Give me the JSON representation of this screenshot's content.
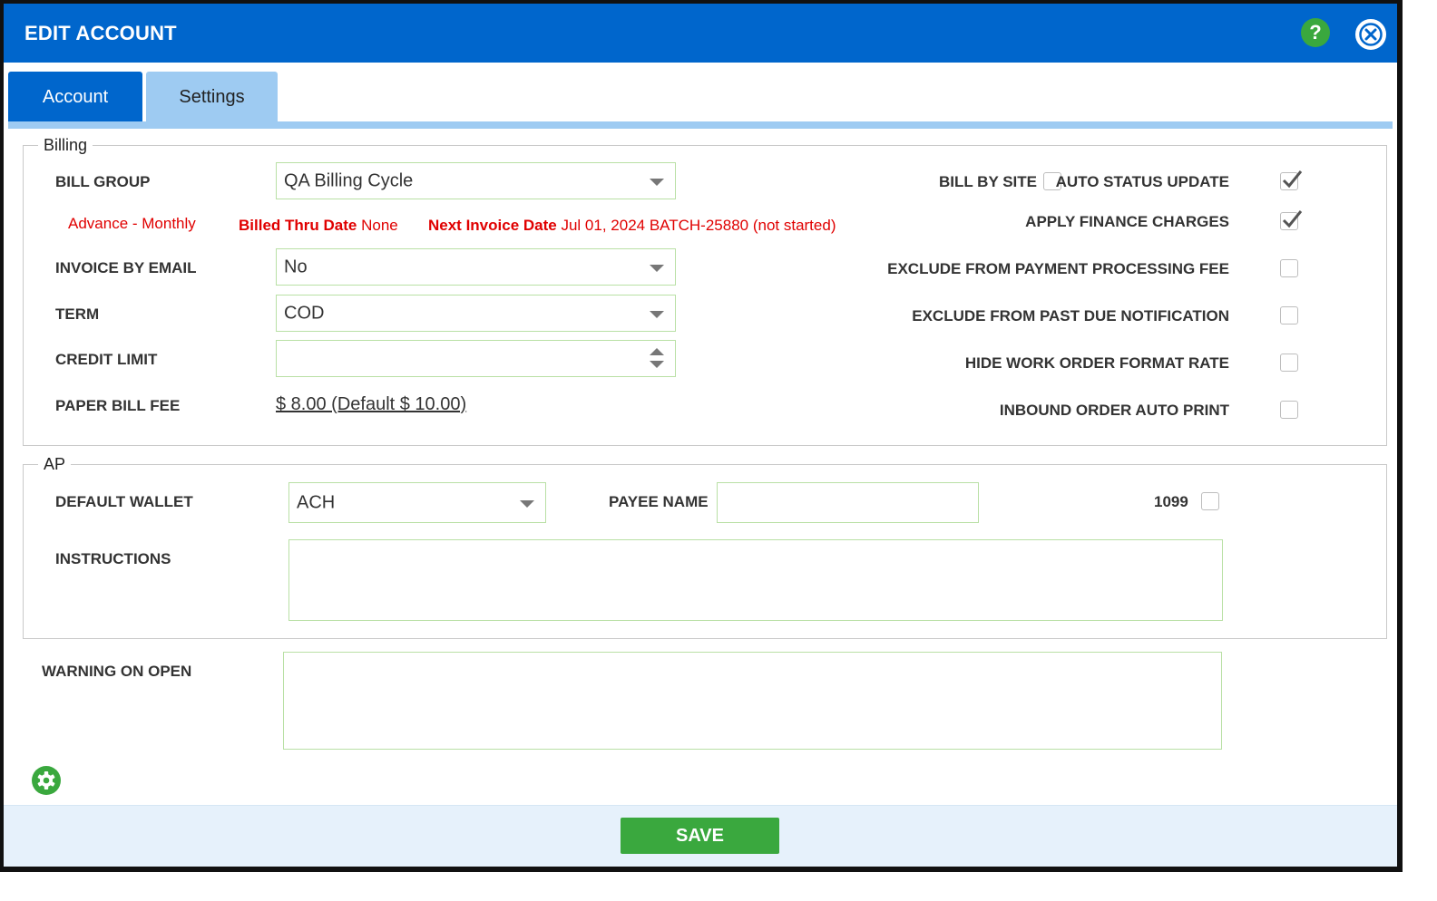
{
  "dialog": {
    "title": "EDIT ACCOUNT",
    "help_icon": "question-mark-icon",
    "help_glyph": "?",
    "close_icon": "close-icon"
  },
  "tabs": [
    {
      "label": "Account",
      "active": true
    },
    {
      "label": "Settings",
      "active": false
    }
  ],
  "billing": {
    "legend": "Billing",
    "bill_group": {
      "label": "BILL GROUP",
      "value": "QA Billing Cycle"
    },
    "cycle_text": "Advance - Monthly",
    "billed_thru": {
      "label": "Billed Thru Date",
      "value": "None"
    },
    "next_invoice": {
      "label": "Next Invoice Date",
      "value": "Jul 01, 2024 BATCH-25880 (not started)"
    },
    "invoice_by_email": {
      "label": "INVOICE BY EMAIL",
      "value": "No"
    },
    "term": {
      "label": "TERM",
      "value": "COD"
    },
    "credit_limit": {
      "label": "CREDIT LIMIT",
      "value": ""
    },
    "paper_bill_fee": {
      "label": "PAPER BILL FEE",
      "value": "$ 8.00 (Default $ 10.00)"
    },
    "checkboxes": [
      {
        "label": "BILL BY SITE",
        "checked": false
      },
      {
        "label": "AUTO STATUS UPDATE",
        "checked": true
      },
      {
        "label": "APPLY FINANCE CHARGES",
        "checked": true
      },
      {
        "label": "EXCLUDE FROM PAYMENT PROCESSING FEE",
        "checked": false
      },
      {
        "label": "EXCLUDE FROM PAST DUE NOTIFICATION",
        "checked": false
      },
      {
        "label": "HIDE WORK ORDER FORMAT RATE",
        "checked": false
      },
      {
        "label": "INBOUND ORDER AUTO PRINT",
        "checked": false
      }
    ]
  },
  "ap": {
    "legend": "AP",
    "default_wallet": {
      "label": "DEFAULT WALLET",
      "value": "ACH"
    },
    "payee_name": {
      "label": "PAYEE NAME",
      "value": ""
    },
    "form_1099": {
      "label": "1099",
      "checked": false
    },
    "instructions": {
      "label": "INSTRUCTIONS",
      "value": ""
    }
  },
  "warning_on_open": {
    "label": "WARNING ON OPEN",
    "value": ""
  },
  "footer": {
    "settings_icon": "gear-icon",
    "save_label": "SAVE"
  },
  "colors": {
    "header_blue": "#0066cc",
    "tab_inactive": "#9ecbf2",
    "accent_green": "#3aa83e",
    "alert_red": "#e00000",
    "field_border": "#b9e0a5"
  }
}
